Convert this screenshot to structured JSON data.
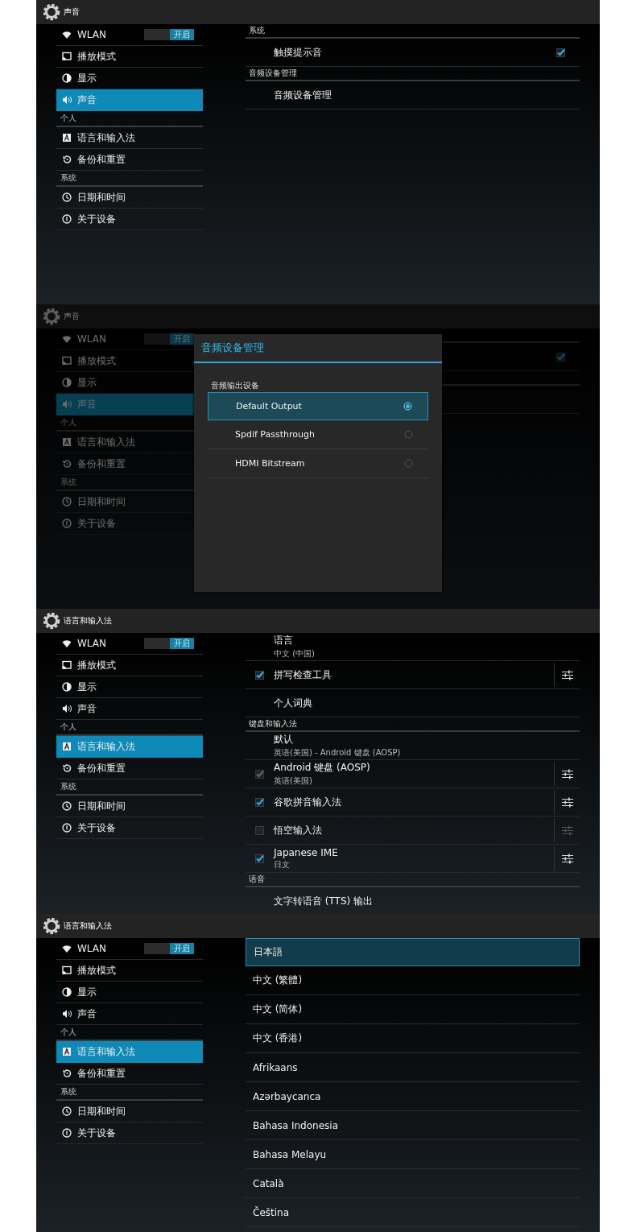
{
  "screens": [
    {
      "title": "声音",
      "sidebar": [
        {
          "kind": "toggle",
          "label": "WLAN",
          "switch": "开启",
          "on": true,
          "selected": false
        },
        {
          "kind": "item",
          "label": "播放模式",
          "selected": false
        },
        {
          "kind": "item",
          "label": "显示",
          "selected": false
        },
        {
          "kind": "item",
          "label": "声音",
          "selected": true
        },
        {
          "kind": "header",
          "label": "个人"
        },
        {
          "kind": "item",
          "label": "语言和输入法",
          "selected": false
        },
        {
          "kind": "item",
          "label": "备份和重置",
          "selected": false
        },
        {
          "kind": "header",
          "label": "系统"
        },
        {
          "kind": "item",
          "label": "日期和时间",
          "selected": false
        },
        {
          "kind": "item",
          "label": "关于设备",
          "selected": false
        }
      ],
      "detail": {
        "kind": "settings",
        "rows": [
          {
            "kind": "header",
            "label": "系统"
          },
          {
            "kind": "check-trail",
            "title": "触摸提示音",
            "checked": true
          },
          {
            "kind": "header",
            "label": "音频设备管理"
          },
          {
            "kind": "text",
            "title": "音频设备管理"
          }
        ]
      }
    },
    {
      "title": "声音",
      "dimmed": true,
      "sidebar": [
        {
          "kind": "toggle",
          "label": "WLAN",
          "switch": "开启",
          "on": true,
          "selected": false
        },
        {
          "kind": "item",
          "label": "播放模式",
          "selected": false
        },
        {
          "kind": "item",
          "label": "显示",
          "selected": false
        },
        {
          "kind": "item",
          "label": "声音",
          "selected": true
        },
        {
          "kind": "header",
          "label": "个人"
        },
        {
          "kind": "item",
          "label": "语言和输入法",
          "selected": false
        },
        {
          "kind": "item",
          "label": "备份和重置",
          "selected": false
        },
        {
          "kind": "header",
          "label": "系统"
        },
        {
          "kind": "item",
          "label": "日期和时间",
          "selected": false
        },
        {
          "kind": "item",
          "label": "关于设备",
          "selected": false
        }
      ],
      "detail": {
        "kind": "settings",
        "rows": [
          {
            "kind": "header"
          },
          {
            "kind": "check-trail",
            "checked": true
          },
          {
            "kind": "header"
          },
          {
            "kind": "text"
          }
        ]
      },
      "dialog": {
        "title": "音频设备管理",
        "section": "音频输出设备",
        "options": [
          {
            "label": "Default Output",
            "selected": true
          },
          {
            "label": "Spdif Passthrough",
            "selected": false
          },
          {
            "label": "HDMI Bitstream",
            "selected": false
          }
        ]
      }
    },
    {
      "title": "语言和输入法",
      "sidebar": [
        {
          "kind": "toggle",
          "label": "WLAN",
          "switch": "开启",
          "on": true,
          "selected": false
        },
        {
          "kind": "item",
          "label": "播放模式",
          "selected": false
        },
        {
          "kind": "item",
          "label": "显示",
          "selected": false
        },
        {
          "kind": "item",
          "label": "声音",
          "selected": false
        },
        {
          "kind": "header",
          "label": "个人"
        },
        {
          "kind": "item",
          "label": "语言和输入法",
          "selected": true
        },
        {
          "kind": "item",
          "label": "备份和重置",
          "selected": false
        },
        {
          "kind": "header",
          "label": "系统"
        },
        {
          "kind": "item",
          "label": "日期和时间",
          "selected": false
        },
        {
          "kind": "item",
          "label": "关于设备",
          "selected": false
        }
      ],
      "detail": {
        "kind": "settings",
        "rows": [
          {
            "kind": "text",
            "title": "语言",
            "subtitle": "中文 (中国)"
          },
          {
            "kind": "check-lead",
            "title": "拼写检查工具",
            "checked": true,
            "check_disabled": false,
            "settings": true,
            "settings_disabled": false
          },
          {
            "kind": "text",
            "title": "个人词典"
          },
          {
            "kind": "header",
            "label": "键盘和输入法"
          },
          {
            "kind": "text",
            "title": "默认",
            "subtitle": "英语(美国) - Android 键盘 (AOSP)"
          },
          {
            "kind": "check-lead",
            "title": "Android 键盘 (AOSP)",
            "subtitle": "英语(美国)",
            "checked": true,
            "check_disabled": true,
            "settings": true,
            "settings_disabled": false
          },
          {
            "kind": "check-lead",
            "title": "谷歌拼音输入法",
            "checked": true,
            "check_disabled": false,
            "settings": true,
            "settings_disabled": false
          },
          {
            "kind": "check-lead",
            "title": "悟空输入法",
            "checked": false,
            "check_disabled": false,
            "settings": true,
            "settings_disabled": true
          },
          {
            "kind": "check-lead",
            "title": "Japanese IME",
            "subtitle": "日文",
            "checked": true,
            "check_disabled": false,
            "settings": true,
            "settings_disabled": false
          },
          {
            "kind": "header",
            "label": "语音"
          },
          {
            "kind": "text",
            "title": "文字转语音 (TTS) 输出"
          }
        ]
      }
    },
    {
      "title": "语言和输入法",
      "sidebar": [
        {
          "kind": "toggle",
          "label": "WLAN",
          "switch": "开启",
          "on": true,
          "selected": false
        },
        {
          "kind": "item",
          "label": "播放模式",
          "selected": false
        },
        {
          "kind": "item",
          "label": "显示",
          "selected": false
        },
        {
          "kind": "item",
          "label": "声音",
          "selected": false
        },
        {
          "kind": "header",
          "label": "个人"
        },
        {
          "kind": "item",
          "label": "语言和输入法",
          "selected": true
        },
        {
          "kind": "item",
          "label": "备份和重置",
          "selected": false
        },
        {
          "kind": "header",
          "label": "系统"
        },
        {
          "kind": "item",
          "label": "日期和时间",
          "selected": false
        },
        {
          "kind": "item",
          "label": "关于设备",
          "selected": false
        }
      ],
      "detail": {
        "kind": "list",
        "items": [
          {
            "label": "日本語",
            "selected": true
          },
          {
            "label": "中文 (繁體)",
            "selected": false
          },
          {
            "label": "中文 (简体)",
            "selected": false
          },
          {
            "label": "中文 (香港)",
            "selected": false
          },
          {
            "label": "Afrikaans",
            "selected": false
          },
          {
            "label": "Azərbaycanca",
            "selected": false
          },
          {
            "label": "Bahasa Indonesia",
            "selected": false
          },
          {
            "label": "Bahasa Melayu",
            "selected": false
          },
          {
            "label": "Català",
            "selected": false
          },
          {
            "label": "Čeština",
            "selected": false
          }
        ]
      }
    }
  ]
}
